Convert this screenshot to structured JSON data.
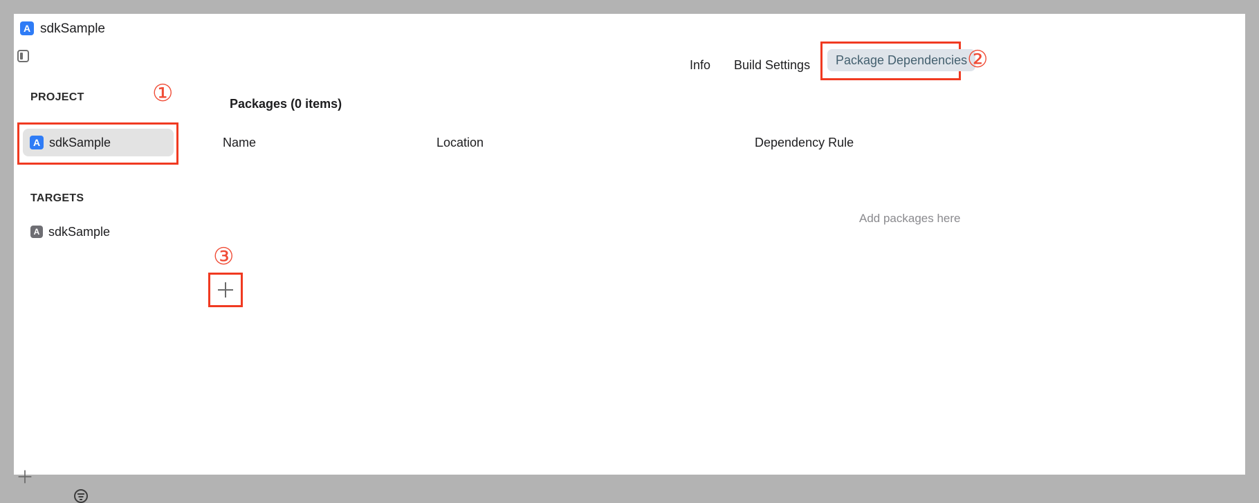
{
  "window": {
    "title": "sdkSample"
  },
  "tabs": [
    {
      "label": "Info",
      "active": false
    },
    {
      "label": "Build Settings",
      "active": false
    },
    {
      "label": "Package Dependencies",
      "active": true
    }
  ],
  "sidebar": {
    "project_header": "PROJECT",
    "project_item": "sdkSample",
    "targets_header": "TARGETS",
    "target_item": "sdkSample"
  },
  "packages": {
    "title": "Packages (0 items)",
    "columns": [
      "Name",
      "Location",
      "Dependency Rule"
    ],
    "empty_message": "Add packages here"
  },
  "annotations": {
    "marker_1": "①",
    "marker_2": "②",
    "marker_3": "③"
  },
  "icons": {
    "app_icon": "xcode-app-icon",
    "sidebar_toggle": "sidebar-toggle-icon",
    "add": "plus-icon",
    "filter": "filter-icon"
  },
  "colors": {
    "annotation_red": "#f03a21",
    "active_tab_bg": "#dfe4ea",
    "active_tab_text": "#44606f",
    "app_icon_blue": "#2f7cf6"
  }
}
